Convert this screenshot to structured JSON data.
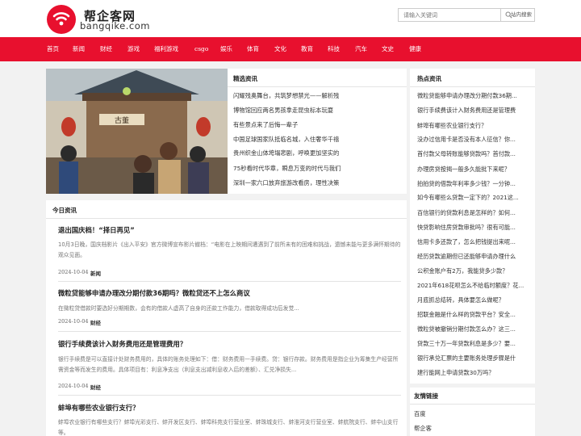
{
  "header": {
    "site_name": "帮企客网",
    "site_domain": "bangqike.com",
    "search_placeholder": "请输入关键词",
    "search_button": "站内搜索",
    "logo_icon": "wifi-signal-icon",
    "brand_color": "#e8102e"
  },
  "nav": {
    "items": [
      "首页",
      "新闻",
      "财经",
      "游戏",
      "福利游戏",
      "csgo",
      "娱乐",
      "体育",
      "文化",
      "教育",
      "科技",
      "汽车",
      "文史",
      "健康"
    ]
  },
  "featured": {
    "image_description": "illustration",
    "sign_text": "古董",
    "title": "精选资讯",
    "items": [
      "闪耀残奥舞台，共筑梦想禁光——解析残",
      "博物馆回应两名男孩拿走昆虫标本玩耍",
      "有些景点来了后悔一辈子",
      "中国足球国家队抵临名城，入住奢华千禧",
      "贵州织金山体垮塌悲剧，呼唤更加坚实的",
      "75秒看时代华章，瞬息万变的时代与我们",
      "深圳一家六口放弃旅游改看房，理性决策"
    ]
  },
  "today": {
    "title": "今日资讯",
    "articles": [
      {
        "title": "退出国庆档！“择日再见”",
        "excerpt": "10月3日晚，国庆档影片《出入平安》官方微博宣布影片撤档：“电影在上映期间遭遇到了前所未有的困难和挑战，遗憾未能与更多满怀期待的观众见面。",
        "date": "2024-10-04",
        "category": "新闻"
      },
      {
        "title": "微粒贷能够申请办理改分期付款36期吗？微粒贷还不上怎么商议",
        "excerpt": "在微粒贷借款时要选好分期期数，会有的借款人虚高了自身的还款工作能力，借款取得成功后发觉...",
        "date": "2024-10-04",
        "category": "财经"
      },
      {
        "title": "银行手续费该计入财务费用还是管理费用？",
        "excerpt": "银行手续费是可以直接计处财务费用的，具体的账务处理如下：借：财务费用—手续费。贷：银行存款。财务费用是指企业为筹集生产经营所需资金等而发生的费用。具体项目有：利息净支出（利息支出减利息收入后的差额）、汇兑净损失...",
        "date": "2024-10-04",
        "category": "财经"
      },
      {
        "title": "蚌埠有哪些农业银行支行？",
        "excerpt": "蚌埠农业银行有哪些支行？蚌埠光彩支行、蚌开发区支行、蚌埠科苑支行营业室、蚌珠城支行、蚌淮河支行营业室、蚌航院支行、蚌中山支行等。",
        "date": "",
        "category": ""
      }
    ]
  },
  "hot": {
    "title": "热点资讯",
    "items": [
      "微粒贷能够申请办理改分期付款36期...",
      "银行手续费该计入财务费用还是管理费",
      "蚌埠有哪些农业银行支行？",
      "没办过信用卡是否没有本人征信？你...",
      "首付款父母转账能够贷款吗？首付款...",
      "办理房贷按揭一般多久能批下来呢？",
      "拍拍贷的借款年利率多少钱？一分钟...",
      "如今有哪些么贷款一定下的？2021这...",
      "百信银行的贷款利息是怎样的？如何...",
      "快贷影响住房贷款审批吗？很有可能...",
      "信用卡多还款了，怎么把钱提出来呢...",
      "经历贷款逾期但已还能够申请办理什么",
      "公积金账户有2万，我能贷多少款？",
      "2021年618花呗怎么不给临时额度？花...",
      "月底抓总结转，具体要怎么做呢？",
      "招联金融是什么样的贷款平台？安全...",
      "微粒贷被撤销分期付款怎么办？这三...",
      "贷款三十万一年贷款利息是多少？要...",
      "银行承兑汇票的主要账务处理步骤是什",
      "建行能网上申请贷款30万吗？"
    ]
  },
  "links": {
    "title": "友情链接",
    "items": [
      "百度",
      "帮企客"
    ]
  }
}
